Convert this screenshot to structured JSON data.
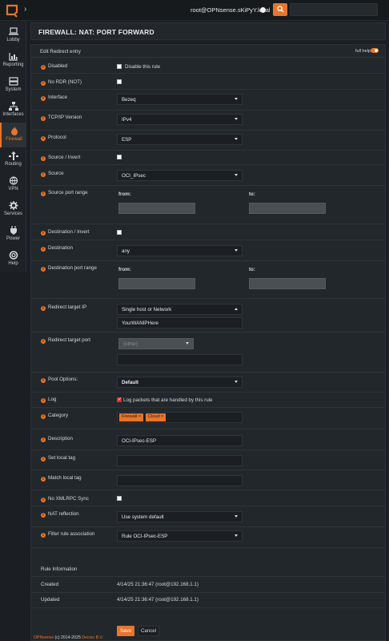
{
  "topbar": {
    "user": "root@OPNsense.sKiPyY.local",
    "search_icon": "search-icon",
    "search_placeholder": ""
  },
  "sidebar": {
    "items": [
      {
        "label": "Lobby",
        "icon": "laptop-icon"
      },
      {
        "label": "Reporting",
        "icon": "chart-icon"
      },
      {
        "label": "System",
        "icon": "server-icon"
      },
      {
        "label": "Interfaces",
        "icon": "network-icon"
      },
      {
        "label": "Firewall",
        "icon": "flame-icon",
        "active": true
      },
      {
        "label": "Routing",
        "icon": "routing-icon"
      },
      {
        "label": "VPN",
        "icon": "globe-icon"
      },
      {
        "label": "Services",
        "icon": "gear-icon"
      },
      {
        "label": "Power",
        "icon": "plug-icon"
      },
      {
        "label": "Help",
        "icon": "lifebuoy-icon"
      }
    ]
  },
  "page": {
    "title": "FIREWALL: NAT: PORT FORWARD",
    "panel_heading": "Edit Redirect entry",
    "full_help": "full help"
  },
  "form": {
    "disabled": {
      "label": "Disabled",
      "check_label": "Disable this rule",
      "checked": false
    },
    "no_rdr": {
      "label": "No RDR (NOT)",
      "checked": false
    },
    "interface": {
      "label": "Interface",
      "value": "Bezeq"
    },
    "tcpip": {
      "label": "TCP/IP Version",
      "value": "IPv4"
    },
    "protocol": {
      "label": "Protocol",
      "value": "ESP"
    },
    "source_invert": {
      "label": "Source / Invert",
      "checked": false
    },
    "source": {
      "label": "Source",
      "value": "OCI_IPsec"
    },
    "source_port_range": {
      "label": "Source port range",
      "from": "from:",
      "to": "to:"
    },
    "dest_invert": {
      "label": "Destination / Invert",
      "checked": false
    },
    "destination": {
      "label": "Destination",
      "value": "any"
    },
    "dest_port_range": {
      "label": "Destination port range",
      "from": "from:",
      "to": "to:"
    },
    "redirect_ip": {
      "label": "Redirect target IP",
      "type_value": "Single host or Network",
      "value": "YourWANIPHere"
    },
    "redirect_port": {
      "label": "Redirect target port",
      "value": "(other)"
    },
    "pool_options": {
      "label": "Pool Options:",
      "value": "Default"
    },
    "log": {
      "label": "Log",
      "check_label": "Log packets that are handled by this rule",
      "checked": true
    },
    "category": {
      "label": "Category",
      "tags": [
        "Firewall ×",
        "Cloud ×"
      ]
    },
    "description": {
      "label": "Description",
      "value": "OCI-IPsec-ESP"
    },
    "set_local_tag": {
      "label": "Set local tag",
      "value": ""
    },
    "match_local_tag": {
      "label": "Match local tag",
      "value": ""
    },
    "no_xmlrpc": {
      "label": "No XMLRPC Sync",
      "checked": false
    },
    "nat_reflection": {
      "label": "NAT reflection",
      "value": "Use system default"
    },
    "filter_rule": {
      "label": "Filter rule association",
      "value": "Rule OCI-IPsec-ESP"
    }
  },
  "rule_info": {
    "heading": "Rule Information",
    "created_label": "Created",
    "created_value": "4/14/25 21:36:47 (root@192.168.1.1)",
    "updated_label": "Updated",
    "updated_value": "4/14/25 21:36:47 (root@192.168.1.1)"
  },
  "buttons": {
    "save": "Save",
    "cancel": "Cancel"
  },
  "footer": {
    "brand": "OPNsense",
    "rest": " (c) 2014-2025 ",
    "company": "Deciso B.V."
  },
  "colors": {
    "accent": "#e8752a",
    "background": "#1b1f23",
    "panel": "#22272b"
  }
}
